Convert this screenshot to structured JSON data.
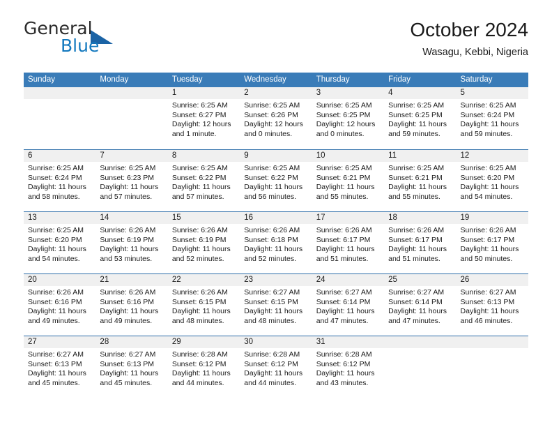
{
  "brand": {
    "name_top": "General",
    "name_bottom": "Blue",
    "flag_icon": "triangle-flag-icon",
    "color_top": "#2b2b2b",
    "color_bottom": "#1278be",
    "flag_color": "#1b63a5"
  },
  "header": {
    "title": "October 2024",
    "subtitle": "Wasagu, Kebbi, Nigeria"
  },
  "theme": {
    "header_bg": "#3a7cb8",
    "row_divider": "#2b6ca8",
    "daynum_bg": "#f0f0f0",
    "text": "#1a1a1a"
  },
  "calendar": {
    "weekdays": [
      "Sunday",
      "Monday",
      "Tuesday",
      "Wednesday",
      "Thursday",
      "Friday",
      "Saturday"
    ],
    "weeks": [
      [
        {
          "day": "",
          "lines": []
        },
        {
          "day": "",
          "lines": []
        },
        {
          "day": "1",
          "lines": [
            "Sunrise: 6:25 AM",
            "Sunset: 6:27 PM",
            "Daylight: 12 hours",
            "and 1 minute."
          ]
        },
        {
          "day": "2",
          "lines": [
            "Sunrise: 6:25 AM",
            "Sunset: 6:26 PM",
            "Daylight: 12 hours",
            "and 0 minutes."
          ]
        },
        {
          "day": "3",
          "lines": [
            "Sunrise: 6:25 AM",
            "Sunset: 6:25 PM",
            "Daylight: 12 hours",
            "and 0 minutes."
          ]
        },
        {
          "day": "4",
          "lines": [
            "Sunrise: 6:25 AM",
            "Sunset: 6:25 PM",
            "Daylight: 11 hours",
            "and 59 minutes."
          ]
        },
        {
          "day": "5",
          "lines": [
            "Sunrise: 6:25 AM",
            "Sunset: 6:24 PM",
            "Daylight: 11 hours",
            "and 59 minutes."
          ]
        }
      ],
      [
        {
          "day": "6",
          "lines": [
            "Sunrise: 6:25 AM",
            "Sunset: 6:24 PM",
            "Daylight: 11 hours",
            "and 58 minutes."
          ]
        },
        {
          "day": "7",
          "lines": [
            "Sunrise: 6:25 AM",
            "Sunset: 6:23 PM",
            "Daylight: 11 hours",
            "and 57 minutes."
          ]
        },
        {
          "day": "8",
          "lines": [
            "Sunrise: 6:25 AM",
            "Sunset: 6:22 PM",
            "Daylight: 11 hours",
            "and 57 minutes."
          ]
        },
        {
          "day": "9",
          "lines": [
            "Sunrise: 6:25 AM",
            "Sunset: 6:22 PM",
            "Daylight: 11 hours",
            "and 56 minutes."
          ]
        },
        {
          "day": "10",
          "lines": [
            "Sunrise: 6:25 AM",
            "Sunset: 6:21 PM",
            "Daylight: 11 hours",
            "and 55 minutes."
          ]
        },
        {
          "day": "11",
          "lines": [
            "Sunrise: 6:25 AM",
            "Sunset: 6:21 PM",
            "Daylight: 11 hours",
            "and 55 minutes."
          ]
        },
        {
          "day": "12",
          "lines": [
            "Sunrise: 6:25 AM",
            "Sunset: 6:20 PM",
            "Daylight: 11 hours",
            "and 54 minutes."
          ]
        }
      ],
      [
        {
          "day": "13",
          "lines": [
            "Sunrise: 6:25 AM",
            "Sunset: 6:20 PM",
            "Daylight: 11 hours",
            "and 54 minutes."
          ]
        },
        {
          "day": "14",
          "lines": [
            "Sunrise: 6:26 AM",
            "Sunset: 6:19 PM",
            "Daylight: 11 hours",
            "and 53 minutes."
          ]
        },
        {
          "day": "15",
          "lines": [
            "Sunrise: 6:26 AM",
            "Sunset: 6:19 PM",
            "Daylight: 11 hours",
            "and 52 minutes."
          ]
        },
        {
          "day": "16",
          "lines": [
            "Sunrise: 6:26 AM",
            "Sunset: 6:18 PM",
            "Daylight: 11 hours",
            "and 52 minutes."
          ]
        },
        {
          "day": "17",
          "lines": [
            "Sunrise: 6:26 AM",
            "Sunset: 6:17 PM",
            "Daylight: 11 hours",
            "and 51 minutes."
          ]
        },
        {
          "day": "18",
          "lines": [
            "Sunrise: 6:26 AM",
            "Sunset: 6:17 PM",
            "Daylight: 11 hours",
            "and 51 minutes."
          ]
        },
        {
          "day": "19",
          "lines": [
            "Sunrise: 6:26 AM",
            "Sunset: 6:17 PM",
            "Daylight: 11 hours",
            "and 50 minutes."
          ]
        }
      ],
      [
        {
          "day": "20",
          "lines": [
            "Sunrise: 6:26 AM",
            "Sunset: 6:16 PM",
            "Daylight: 11 hours",
            "and 49 minutes."
          ]
        },
        {
          "day": "21",
          "lines": [
            "Sunrise: 6:26 AM",
            "Sunset: 6:16 PM",
            "Daylight: 11 hours",
            "and 49 minutes."
          ]
        },
        {
          "day": "22",
          "lines": [
            "Sunrise: 6:26 AM",
            "Sunset: 6:15 PM",
            "Daylight: 11 hours",
            "and 48 minutes."
          ]
        },
        {
          "day": "23",
          "lines": [
            "Sunrise: 6:27 AM",
            "Sunset: 6:15 PM",
            "Daylight: 11 hours",
            "and 48 minutes."
          ]
        },
        {
          "day": "24",
          "lines": [
            "Sunrise: 6:27 AM",
            "Sunset: 6:14 PM",
            "Daylight: 11 hours",
            "and 47 minutes."
          ]
        },
        {
          "day": "25",
          "lines": [
            "Sunrise: 6:27 AM",
            "Sunset: 6:14 PM",
            "Daylight: 11 hours",
            "and 47 minutes."
          ]
        },
        {
          "day": "26",
          "lines": [
            "Sunrise: 6:27 AM",
            "Sunset: 6:13 PM",
            "Daylight: 11 hours",
            "and 46 minutes."
          ]
        }
      ],
      [
        {
          "day": "27",
          "lines": [
            "Sunrise: 6:27 AM",
            "Sunset: 6:13 PM",
            "Daylight: 11 hours",
            "and 45 minutes."
          ]
        },
        {
          "day": "28",
          "lines": [
            "Sunrise: 6:27 AM",
            "Sunset: 6:13 PM",
            "Daylight: 11 hours",
            "and 45 minutes."
          ]
        },
        {
          "day": "29",
          "lines": [
            "Sunrise: 6:28 AM",
            "Sunset: 6:12 PM",
            "Daylight: 11 hours",
            "and 44 minutes."
          ]
        },
        {
          "day": "30",
          "lines": [
            "Sunrise: 6:28 AM",
            "Sunset: 6:12 PM",
            "Daylight: 11 hours",
            "and 44 minutes."
          ]
        },
        {
          "day": "31",
          "lines": [
            "Sunrise: 6:28 AM",
            "Sunset: 6:12 PM",
            "Daylight: 11 hours",
            "and 43 minutes."
          ]
        },
        {
          "day": "",
          "lines": []
        },
        {
          "day": "",
          "lines": []
        }
      ]
    ]
  }
}
